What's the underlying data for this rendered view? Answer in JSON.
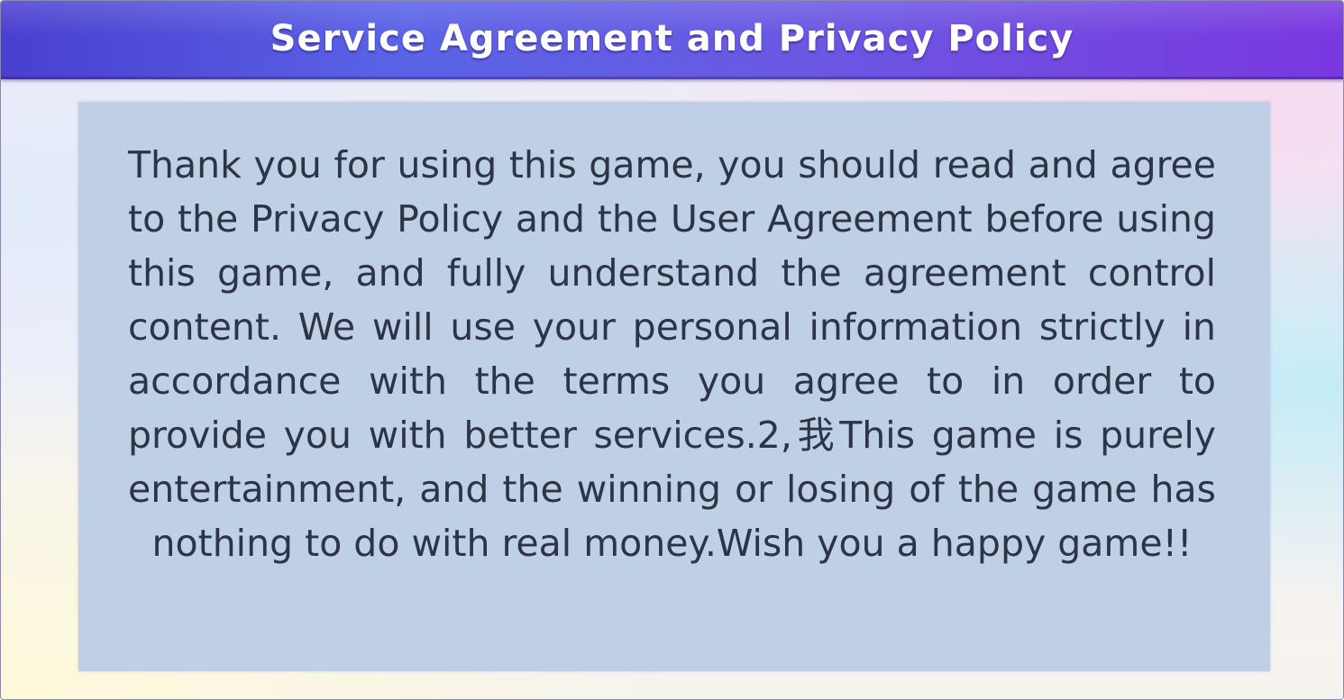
{
  "dialog": {
    "title": "Service Agreement and Privacy Policy",
    "body": "Thank you for using this game, you should read and agree to the Privacy Policy and the User Agreement before using this game, and fully understand the agree­ment control content. We will use your personal informa­tion strictly in accordance with the terms you agree to in order to provide you with better services.2,我This game is purely entertainment, and the winning or losing of the game has nothing to do with real money.Wish you a happy game!!"
  },
  "colors": {
    "title_bar_start": "#4a3fd0",
    "title_bar_end": "#7a38e0",
    "title_text": "#ffffff",
    "panel_background": "#bfd0e6",
    "body_text": "#2c3445"
  }
}
